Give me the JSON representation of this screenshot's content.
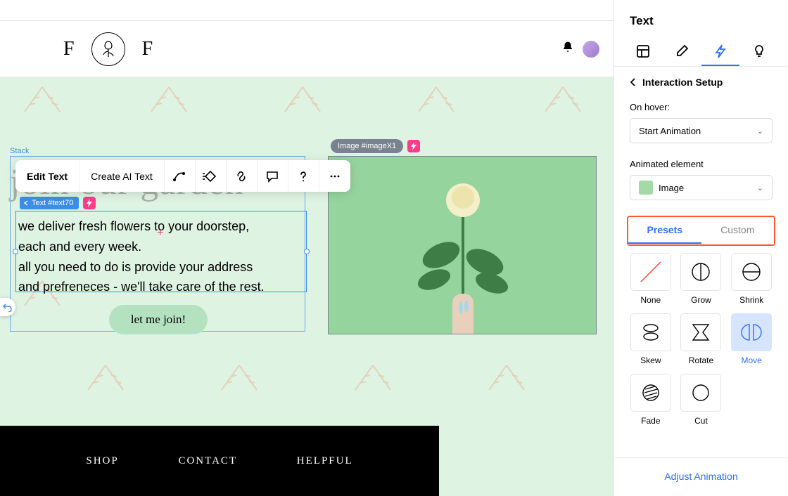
{
  "header": {
    "logo_left": "F",
    "logo_right": "F"
  },
  "canvas": {
    "stack_label": "Stack",
    "hero": "join our garden",
    "text_badge": "Text #text70",
    "body_l1": "we deliver fresh flowers to your doorstep,",
    "body_l2": "each and every week.",
    "body_l3": "all you need to do is provide your address",
    "body_l4": "and prefreneces - we'll take care of the rest.",
    "join": "let me join!",
    "image_badge": "Image #imageX1"
  },
  "toolbar": {
    "edit": "Edit Text",
    "ai": "Create AI Text"
  },
  "footer": {
    "shop": "SHOP",
    "contact": "CONTACT",
    "help": "HELPFUL"
  },
  "panel": {
    "title": "Text",
    "back": "Interaction Setup",
    "hover_label": "On hover:",
    "hover_value": "Start Animation",
    "anim_label": "Animated element",
    "anim_value": "Image",
    "sub_presets": "Presets",
    "sub_custom": "Custom",
    "presets": {
      "none": "None",
      "grow": "Grow",
      "shrink": "Shrink",
      "skew": "Skew",
      "rotate": "Rotate",
      "move": "Move",
      "fade": "Fade",
      "cut": "Cut"
    },
    "adjust": "Adjust Animation"
  }
}
